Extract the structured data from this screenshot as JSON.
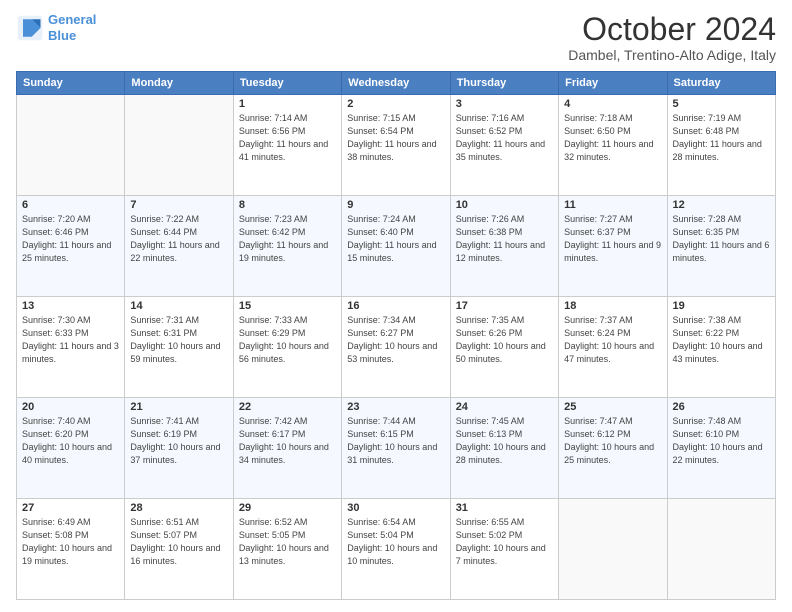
{
  "logo": {
    "line1": "General",
    "line2": "Blue"
  },
  "title": "October 2024",
  "subtitle": "Dambel, Trentino-Alto Adige, Italy",
  "days_of_week": [
    "Sunday",
    "Monday",
    "Tuesday",
    "Wednesday",
    "Thursday",
    "Friday",
    "Saturday"
  ],
  "weeks": [
    [
      {
        "day": "",
        "info": ""
      },
      {
        "day": "",
        "info": ""
      },
      {
        "day": "1",
        "info": "Sunrise: 7:14 AM\nSunset: 6:56 PM\nDaylight: 11 hours and 41 minutes."
      },
      {
        "day": "2",
        "info": "Sunrise: 7:15 AM\nSunset: 6:54 PM\nDaylight: 11 hours and 38 minutes."
      },
      {
        "day": "3",
        "info": "Sunrise: 7:16 AM\nSunset: 6:52 PM\nDaylight: 11 hours and 35 minutes."
      },
      {
        "day": "4",
        "info": "Sunrise: 7:18 AM\nSunset: 6:50 PM\nDaylight: 11 hours and 32 minutes."
      },
      {
        "day": "5",
        "info": "Sunrise: 7:19 AM\nSunset: 6:48 PM\nDaylight: 11 hours and 28 minutes."
      }
    ],
    [
      {
        "day": "6",
        "info": "Sunrise: 7:20 AM\nSunset: 6:46 PM\nDaylight: 11 hours and 25 minutes."
      },
      {
        "day": "7",
        "info": "Sunrise: 7:22 AM\nSunset: 6:44 PM\nDaylight: 11 hours and 22 minutes."
      },
      {
        "day": "8",
        "info": "Sunrise: 7:23 AM\nSunset: 6:42 PM\nDaylight: 11 hours and 19 minutes."
      },
      {
        "day": "9",
        "info": "Sunrise: 7:24 AM\nSunset: 6:40 PM\nDaylight: 11 hours and 15 minutes."
      },
      {
        "day": "10",
        "info": "Sunrise: 7:26 AM\nSunset: 6:38 PM\nDaylight: 11 hours and 12 minutes."
      },
      {
        "day": "11",
        "info": "Sunrise: 7:27 AM\nSunset: 6:37 PM\nDaylight: 11 hours and 9 minutes."
      },
      {
        "day": "12",
        "info": "Sunrise: 7:28 AM\nSunset: 6:35 PM\nDaylight: 11 hours and 6 minutes."
      }
    ],
    [
      {
        "day": "13",
        "info": "Sunrise: 7:30 AM\nSunset: 6:33 PM\nDaylight: 11 hours and 3 minutes."
      },
      {
        "day": "14",
        "info": "Sunrise: 7:31 AM\nSunset: 6:31 PM\nDaylight: 10 hours and 59 minutes."
      },
      {
        "day": "15",
        "info": "Sunrise: 7:33 AM\nSunset: 6:29 PM\nDaylight: 10 hours and 56 minutes."
      },
      {
        "day": "16",
        "info": "Sunrise: 7:34 AM\nSunset: 6:27 PM\nDaylight: 10 hours and 53 minutes."
      },
      {
        "day": "17",
        "info": "Sunrise: 7:35 AM\nSunset: 6:26 PM\nDaylight: 10 hours and 50 minutes."
      },
      {
        "day": "18",
        "info": "Sunrise: 7:37 AM\nSunset: 6:24 PM\nDaylight: 10 hours and 47 minutes."
      },
      {
        "day": "19",
        "info": "Sunrise: 7:38 AM\nSunset: 6:22 PM\nDaylight: 10 hours and 43 minutes."
      }
    ],
    [
      {
        "day": "20",
        "info": "Sunrise: 7:40 AM\nSunset: 6:20 PM\nDaylight: 10 hours and 40 minutes."
      },
      {
        "day": "21",
        "info": "Sunrise: 7:41 AM\nSunset: 6:19 PM\nDaylight: 10 hours and 37 minutes."
      },
      {
        "day": "22",
        "info": "Sunrise: 7:42 AM\nSunset: 6:17 PM\nDaylight: 10 hours and 34 minutes."
      },
      {
        "day": "23",
        "info": "Sunrise: 7:44 AM\nSunset: 6:15 PM\nDaylight: 10 hours and 31 minutes."
      },
      {
        "day": "24",
        "info": "Sunrise: 7:45 AM\nSunset: 6:13 PM\nDaylight: 10 hours and 28 minutes."
      },
      {
        "day": "25",
        "info": "Sunrise: 7:47 AM\nSunset: 6:12 PM\nDaylight: 10 hours and 25 minutes."
      },
      {
        "day": "26",
        "info": "Sunrise: 7:48 AM\nSunset: 6:10 PM\nDaylight: 10 hours and 22 minutes."
      }
    ],
    [
      {
        "day": "27",
        "info": "Sunrise: 6:49 AM\nSunset: 5:08 PM\nDaylight: 10 hours and 19 minutes."
      },
      {
        "day": "28",
        "info": "Sunrise: 6:51 AM\nSunset: 5:07 PM\nDaylight: 10 hours and 16 minutes."
      },
      {
        "day": "29",
        "info": "Sunrise: 6:52 AM\nSunset: 5:05 PM\nDaylight: 10 hours and 13 minutes."
      },
      {
        "day": "30",
        "info": "Sunrise: 6:54 AM\nSunset: 5:04 PM\nDaylight: 10 hours and 10 minutes."
      },
      {
        "day": "31",
        "info": "Sunrise: 6:55 AM\nSunset: 5:02 PM\nDaylight: 10 hours and 7 minutes."
      },
      {
        "day": "",
        "info": ""
      },
      {
        "day": "",
        "info": ""
      }
    ]
  ]
}
